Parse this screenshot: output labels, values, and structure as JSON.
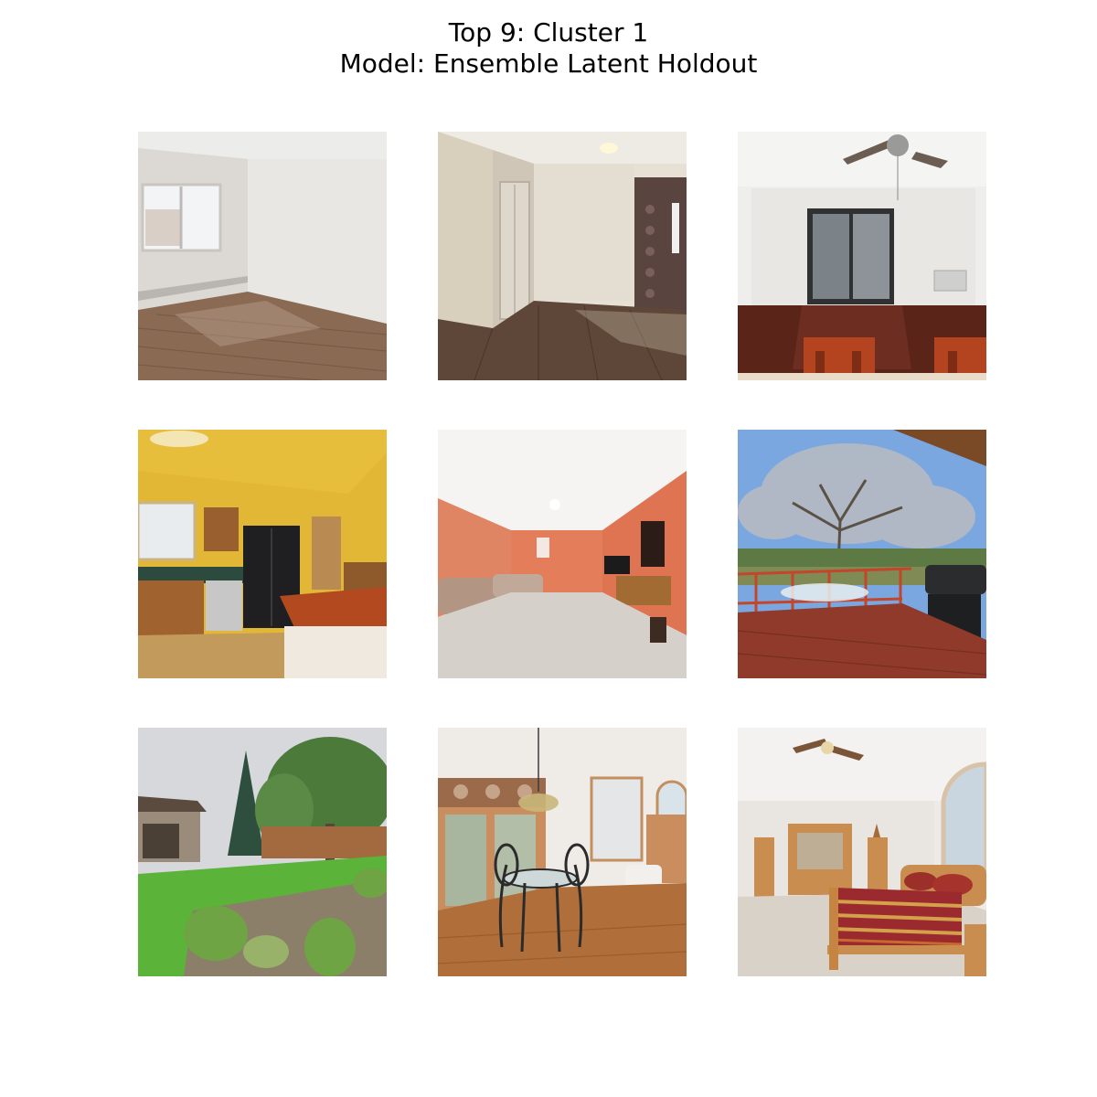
{
  "figure": {
    "title_line_1": "Top 9: Cluster 1",
    "title_line_2": "Model: Ensemble Latent Holdout"
  },
  "images": [
    {
      "rank": 1,
      "depicts": "empty-room-window-wood-floor"
    },
    {
      "rank": 2,
      "depicts": "empty-room-closet-door-wood-floor"
    },
    {
      "rank": 3,
      "depicts": "dining-room-sliding-door-ceiling-fan"
    },
    {
      "rank": 4,
      "depicts": "kitchen-yellow-walls-fridge"
    },
    {
      "rank": 5,
      "depicts": "living-room-orange-walls-sofa"
    },
    {
      "rank": 6,
      "depicts": "deck-tree-grill"
    },
    {
      "rank": 7,
      "depicts": "backyard-lawn-trees"
    },
    {
      "rank": 8,
      "depicts": "dining-nook-table-chairs"
    },
    {
      "rank": 9,
      "depicts": "bedroom-striped-bed-ceiling-fan"
    }
  ]
}
